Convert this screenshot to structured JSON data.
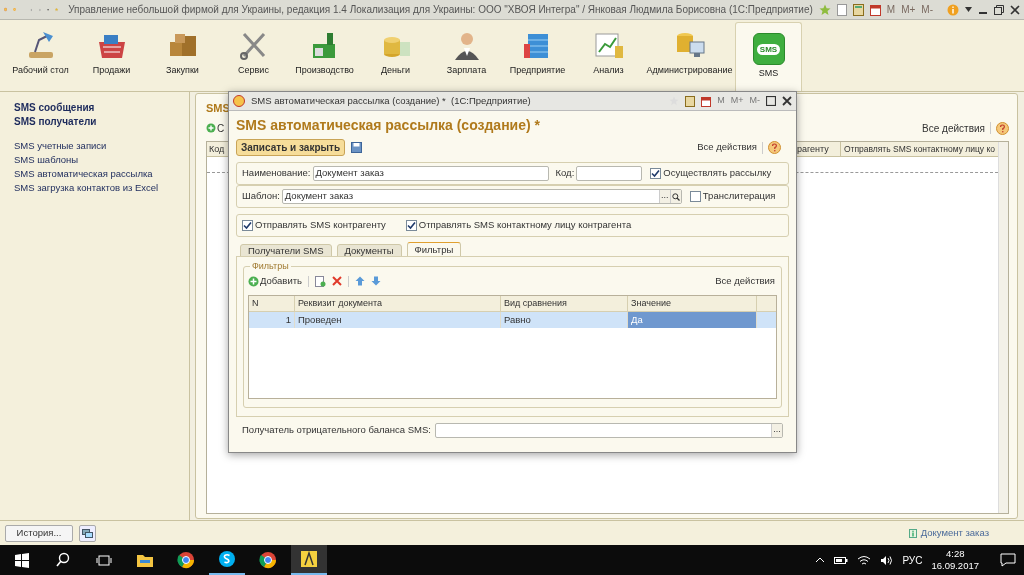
{
  "window": {
    "title": "Управление небольшой фирмой для Украины, редакция 1.4 Локализация для Украины: ООО \"ХВОЯ Интегра\" / Янковая Людмила Борисовна  (1С:Предприятие)",
    "calc_buttons": [
      "M",
      "M+",
      "M-"
    ]
  },
  "sections": [
    {
      "label": "Рабочий стол",
      "selected": false
    },
    {
      "label": "Продажи",
      "selected": false
    },
    {
      "label": "Закупки",
      "selected": false
    },
    {
      "label": "Сервис",
      "selected": false
    },
    {
      "label": "Производство",
      "selected": false
    },
    {
      "label": "Деньги",
      "selected": false
    },
    {
      "label": "Зарплата",
      "selected": false
    },
    {
      "label": "Предприятие",
      "selected": false
    },
    {
      "label": "Анализ",
      "selected": false
    },
    {
      "label": "Администрирование",
      "selected": false
    },
    {
      "label": "SMS",
      "selected": true,
      "badge": "SMS"
    }
  ],
  "nav": [
    {
      "label": "SMS сообщения",
      "kind": "main"
    },
    {
      "label": "SMS получатели",
      "kind": "main"
    },
    {
      "label": "SMS учетные записи",
      "kind": "service"
    },
    {
      "label": "SMS шаблоны",
      "kind": "service"
    },
    {
      "label": "SMS автоматическая рассылка",
      "kind": "service"
    },
    {
      "label": "SMS загрузка контактов из Excel",
      "kind": "service"
    }
  ],
  "list_window": {
    "title": "SMS",
    "create_button": "С",
    "all_actions": "Все действия",
    "columns": [
      "Код",
      "рагенту",
      "Отправлять SMS контактному лицу ко"
    ]
  },
  "dialog": {
    "title": "SMS автоматическая рассылка (создание) *  (1С:Предприятие)",
    "calc_buttons": [
      "M",
      "M+",
      "M-"
    ],
    "heading": "SMS автоматическая рассылка (создание) *",
    "save_close": "Записать и закрыть",
    "all_actions": "Все действия",
    "name_label": "Наименование:",
    "name_value": "Документ заказ",
    "code_label": "Код:",
    "mailing": {
      "label": "Осуществлять рассылку",
      "checked": true
    },
    "template_label": "Шаблон:",
    "template_value": "Документ заказ",
    "choice_button": "...",
    "translit": {
      "label": "Транслитерация",
      "checked": false
    },
    "send_options": [
      {
        "label": "Отправлять SMS контрагенту",
        "checked": true
      },
      {
        "label": "Отправлять SMS контактному лицу контрагента",
        "checked": true
      }
    ],
    "tabs": [
      {
        "label": "Получатели SMS",
        "selected": false
      },
      {
        "label": "Документы",
        "selected": false
      },
      {
        "label": "Фильтры",
        "selected": true
      }
    ],
    "filters": {
      "title": "Фильтры",
      "add_button": "Добавить",
      "all_actions": "Все действия",
      "columns": [
        "N",
        "Реквизит документа",
        "Вид сравнения",
        "Значение"
      ],
      "rows": [
        {
          "cells": [
            "1",
            "Проведен",
            "Равно",
            "Да"
          ],
          "selected": true
        }
      ]
    },
    "balance_label": "Получатель отрицательного баланса SMS:",
    "balance_choice": "..."
  },
  "bottom": {
    "history_button": "История...",
    "status_link": "Документ заказ"
  },
  "taskbar": {
    "language": "РУС",
    "time": "4:28",
    "date": "16.09.2017"
  }
}
